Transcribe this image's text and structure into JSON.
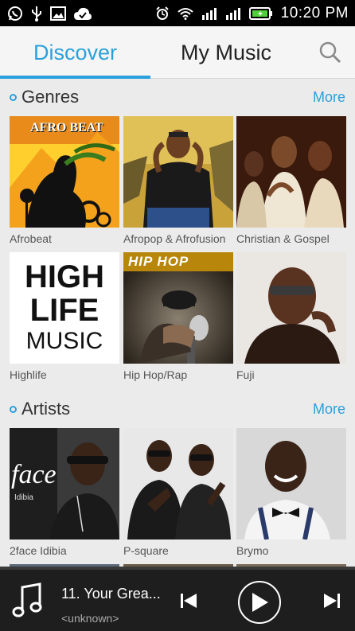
{
  "status_bar": {
    "time": "10:20 PM",
    "left_icons": [
      "whatsapp-icon",
      "usb-icon",
      "image-icon",
      "cloud-check-icon"
    ],
    "right_icons": [
      "alarm-icon",
      "wifi-icon",
      "signal-icon",
      "signal-icon",
      "battery-charging-icon"
    ],
    "battery_color": "#4cd137"
  },
  "header": {
    "tabs": [
      {
        "label": "Discover",
        "active": true
      },
      {
        "label": "My Music",
        "active": false
      }
    ],
    "search_icon": "search-icon",
    "accent_color": "#2aa0dc"
  },
  "genres": {
    "title": "Genres",
    "more": "More",
    "items": [
      {
        "label": "Afrobeat"
      },
      {
        "label": "Afropop & Afrofusion"
      },
      {
        "label": "Christian & Gospel"
      },
      {
        "label": "Highlife"
      },
      {
        "label": "Hip Hop/Rap"
      },
      {
        "label": "Fuji"
      }
    ],
    "art_text": {
      "afrobeat": "AFRO BEAT",
      "highlife": [
        "HIGH",
        "LIFE",
        "MUSIC"
      ],
      "hiphop": "HIP HOP"
    }
  },
  "artists": {
    "title": "Artists",
    "more": "More",
    "items": [
      {
        "label": "2face Idibia"
      },
      {
        "label": "P-square"
      },
      {
        "label": "Brymo"
      }
    ],
    "art_text": {
      "twoface": "face",
      "twoface_sub": "Idibia"
    }
  },
  "player": {
    "track_title": "11. Your Grea...",
    "track_artist": "<unknown>",
    "icons": [
      "music-note-icon",
      "previous-icon",
      "play-icon",
      "next-icon"
    ]
  }
}
